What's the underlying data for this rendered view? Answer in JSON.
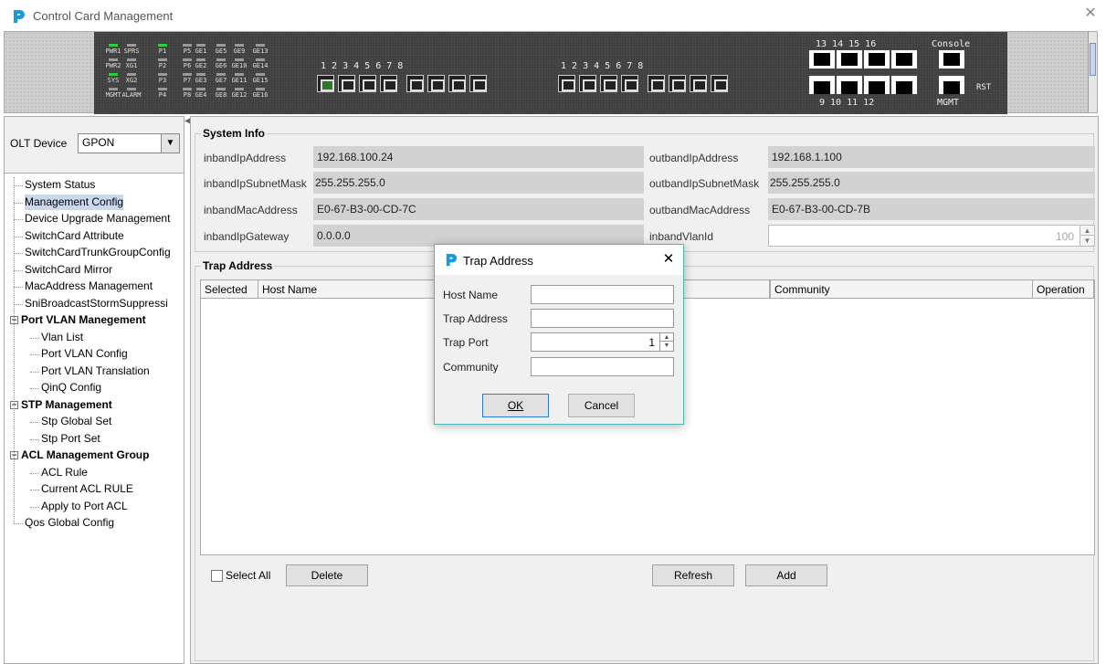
{
  "window": {
    "title": "Control Card Management",
    "close_icon": "close-icon"
  },
  "panel": {
    "leds": {
      "col1": [
        "PWR1",
        "PWR2",
        "SYS",
        "MGMT"
      ],
      "col2": [
        "SPRS",
        "XG1",
        "XG2",
        "ALARM"
      ],
      "col3": [
        "P1",
        "P2",
        "P3",
        "P4"
      ],
      "col4": [
        "P5",
        "P6",
        "P7",
        "P8"
      ],
      "col5": [
        "GE1",
        "GE2",
        "GE3",
        "GE4"
      ],
      "col6": [
        "GE5",
        "GE6",
        "GE7",
        "GE8"
      ],
      "col7": [
        "GE9",
        "GE10",
        "GE11",
        "GE12"
      ],
      "col8": [
        "GE13",
        "GE14",
        "GE15",
        "GE16"
      ]
    },
    "sfp_group1_numbers": "1   2   3   4    5   6   7   8",
    "sfp_group2_numbers": "1   2   3   4    5   6   7   8",
    "rj_top_numbers": "13  14  15  16",
    "rj_bottom_numbers": "9   10  11  12",
    "console_label": "Console",
    "mgmt_label": "MGMT",
    "rst_label": "RST"
  },
  "left": {
    "olt_label": "OLT Device",
    "olt_value": "GPON",
    "tree": [
      {
        "label": "System Status"
      },
      {
        "label": "Management Config",
        "selected": true
      },
      {
        "label": "Device Upgrade Management"
      },
      {
        "label": "SwitchCard Attribute"
      },
      {
        "label": "SwitchCardTrunkGroupConfig"
      },
      {
        "label": "SwitchCard Mirror"
      },
      {
        "label": "MacAddress Management"
      },
      {
        "label": "SniBroadcastStormSuppressi"
      },
      {
        "label": "Port VLAN Manegement",
        "group": true
      },
      {
        "label": "Vlan List"
      },
      {
        "label": "Port VLAN Config"
      },
      {
        "label": "Port VLAN Translation"
      },
      {
        "label": "QinQ Config"
      },
      {
        "label": "STP Management",
        "group": true
      },
      {
        "label": "Stp Global Set"
      },
      {
        "label": "Stp Port Set"
      },
      {
        "label": "ACL Management Group",
        "group": true
      },
      {
        "label": "ACL Rule"
      },
      {
        "label": "Current ACL RULE"
      },
      {
        "label": "Apply to Port ACL"
      },
      {
        "label": "Qos Global Config"
      }
    ]
  },
  "system_info": {
    "title": "System Info",
    "inband_ip_label": "inbandIpAddress",
    "inband_ip_value": "192.168.100.24",
    "outband_ip_label": "outbandIpAddress",
    "outband_ip_value": "192.168.1.100",
    "inband_mask_label": "inbandIpSubnetMask",
    "inband_mask_value": "255.255.255.0",
    "outband_mask_label": "outbandIpSubnetMask",
    "outband_mask_value": "255.255.255.0",
    "inband_mac_label": "inbandMacAddress",
    "inband_mac_value": "E0-67-B3-00-CD-7C",
    "outband_mac_label": "outbandMacAddress",
    "outband_mac_value": "E0-67-B3-00-CD-7B",
    "inband_gw_label": "inbandIpGateway",
    "inband_gw_value": "0.0.0.0",
    "inband_vlan_label": "inbandVlanId",
    "inband_vlan_value": "100"
  },
  "trap": {
    "title": "Trap Address",
    "columns": [
      "Selected",
      "Host Name",
      "Community",
      "Operation"
    ],
    "select_all": "Select All",
    "delete": "Delete",
    "refresh": "Refresh",
    "add": "Add"
  },
  "dialog": {
    "title": "Trap Address",
    "host_name_label": "Host Name",
    "host_name_value": "",
    "trap_address_label": "Trap Address",
    "trap_address_value": "",
    "trap_port_label": "Trap Port",
    "trap_port_value": "1",
    "community_label": "Community",
    "community_value": "",
    "ok": "OK",
    "cancel": "Cancel"
  },
  "colors": {
    "brand": "#1a9bd7",
    "selection": "#c9d7ef",
    "dialog_border": "#4fb6b6",
    "led_on": "#2ecc40"
  }
}
